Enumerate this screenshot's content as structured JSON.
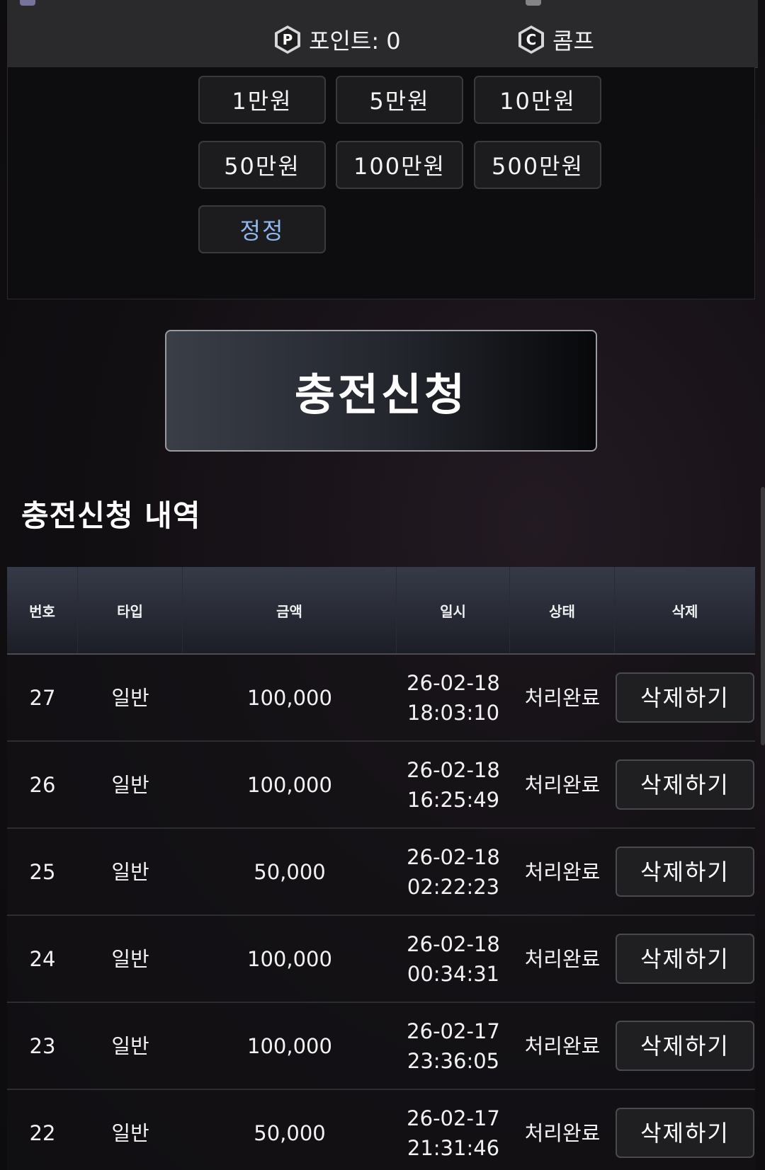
{
  "header": {
    "points_icon": "P",
    "points_label": "포인트: 0",
    "comp_icon": "C",
    "comp_label": "콤프"
  },
  "amount_buttons": [
    "1만원",
    "5만원",
    "10만원",
    "50만원",
    "100만원",
    "500만원",
    "정정"
  ],
  "submit_label": "충전신청",
  "history": {
    "title": "충전신청 내역",
    "columns": [
      "번호",
      "타입",
      "금액",
      "일시",
      "상태",
      "삭제"
    ],
    "rows": [
      {
        "no": "27",
        "type": "일반",
        "amount": "100,000",
        "date": "26-02-18",
        "time": "18:03:10",
        "status": "처리완료",
        "action": "삭제하기"
      },
      {
        "no": "26",
        "type": "일반",
        "amount": "100,000",
        "date": "26-02-18",
        "time": "16:25:49",
        "status": "처리완료",
        "action": "삭제하기"
      },
      {
        "no": "25",
        "type": "일반",
        "amount": "50,000",
        "date": "26-02-18",
        "time": "02:22:23",
        "status": "처리완료",
        "action": "삭제하기"
      },
      {
        "no": "24",
        "type": "일반",
        "amount": "100,000",
        "date": "26-02-18",
        "time": "00:34:31",
        "status": "처리완료",
        "action": "삭제하기"
      },
      {
        "no": "23",
        "type": "일반",
        "amount": "100,000",
        "date": "26-02-17",
        "time": "23:36:05",
        "status": "처리완료",
        "action": "삭제하기"
      },
      {
        "no": "22",
        "type": "일반",
        "amount": "50,000",
        "date": "26-02-17",
        "time": "21:31:46",
        "status": "처리완료",
        "action": "삭제하기"
      }
    ]
  }
}
